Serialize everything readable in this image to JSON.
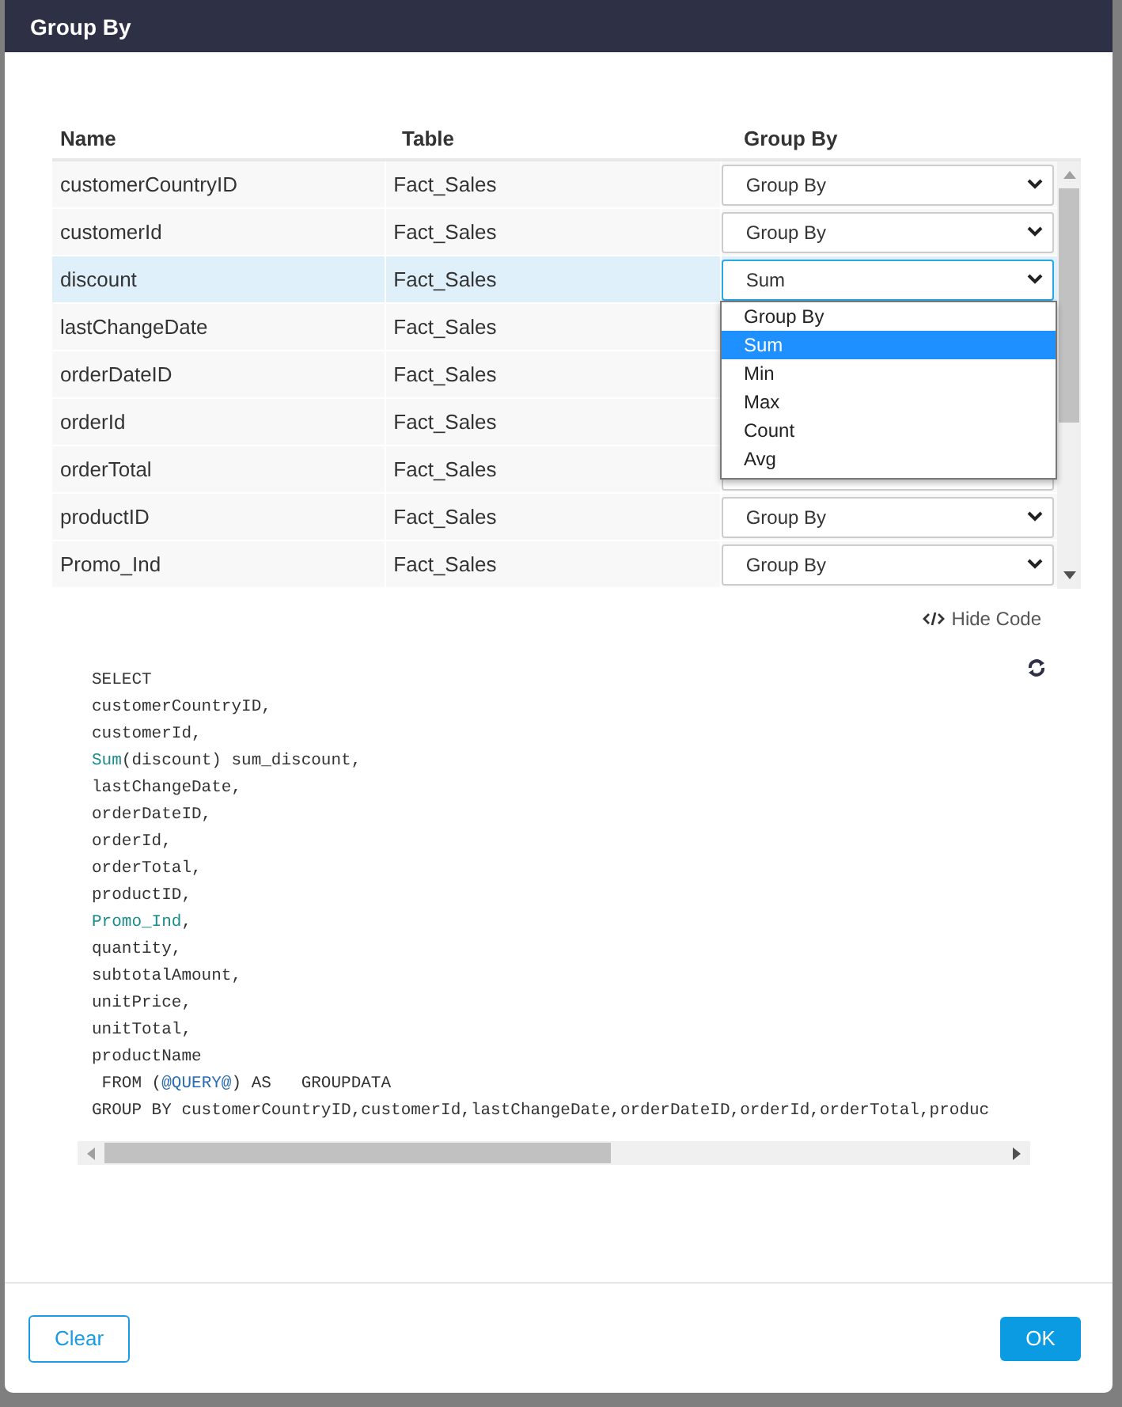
{
  "dialog": {
    "title": "Group By"
  },
  "table": {
    "columns": [
      "Name",
      "Table",
      "Group By"
    ],
    "rows": [
      {
        "name": "customerCountryID",
        "table": "Fact_Sales",
        "group_by": "Group By",
        "selected": false
      },
      {
        "name": "customerId",
        "table": "Fact_Sales",
        "group_by": "Group By",
        "selected": false
      },
      {
        "name": "discount",
        "table": "Fact_Sales",
        "group_by": "Sum",
        "selected": true,
        "menu": [
          {
            "label": "Group By",
            "selected": false
          },
          {
            "label": "Sum",
            "selected": true
          },
          {
            "label": "Min",
            "selected": false
          },
          {
            "label": "Max",
            "selected": false
          },
          {
            "label": "Count",
            "selected": false
          },
          {
            "label": "Avg",
            "selected": false
          }
        ]
      },
      {
        "name": "lastChangeDate",
        "table": "Fact_Sales",
        "selected": false
      },
      {
        "name": "orderDateID",
        "table": "Fact_Sales",
        "selected": false
      },
      {
        "name": "orderId",
        "table": "Fact_Sales",
        "selected": false
      },
      {
        "name": "orderTotal",
        "table": "Fact_Sales",
        "selected": false
      },
      {
        "name": "productID",
        "table": "Fact_Sales",
        "group_by": "Group By",
        "selected": false
      },
      {
        "name": "Promo_Ind",
        "table": "Fact_Sales",
        "group_by": "Group By",
        "selected": false
      }
    ]
  },
  "hide_code_link": "Hide Code",
  "code_lines": [
    [
      {
        "text": "SELECT",
        "kind": "plain"
      }
    ],
    [
      {
        "text": "customerCountryID,",
        "kind": "plain"
      }
    ],
    [
      {
        "text": "customerId,",
        "kind": "plain"
      }
    ],
    [
      {
        "text": "Sum",
        "kind": "function"
      },
      {
        "text": "(discount) sum_discount,",
        "kind": "plain"
      }
    ],
    [
      {
        "text": "lastChangeDate,",
        "kind": "plain"
      }
    ],
    [
      {
        "text": "orderDateID,",
        "kind": "plain"
      }
    ],
    [
      {
        "text": "orderId,",
        "kind": "plain"
      }
    ],
    [
      {
        "text": "orderTotal,",
        "kind": "plain"
      }
    ],
    [
      {
        "text": "productID,",
        "kind": "plain"
      }
    ],
    [
      {
        "text": "Promo_Ind",
        "kind": "function"
      },
      {
        "text": ",",
        "kind": "plain"
      }
    ],
    [
      {
        "text": "quantity,",
        "kind": "plain"
      }
    ],
    [
      {
        "text": "subtotalAmount,",
        "kind": "plain"
      }
    ],
    [
      {
        "text": "unitPrice,",
        "kind": "plain"
      }
    ],
    [
      {
        "text": "unitTotal,",
        "kind": "plain"
      }
    ],
    [
      {
        "text": "productName",
        "kind": "plain"
      }
    ],
    [
      {
        "text": " FROM (",
        "kind": "plain"
      },
      {
        "text": "@QUERY@",
        "kind": "parameter"
      },
      {
        "text": ") AS   GROUPDATA",
        "kind": "plain"
      }
    ],
    [
      {
        "text": "GROUP BY customerCountryID,customerId,lastChangeDate,orderDateID,orderId,orderTotal,produc",
        "kind": "plain"
      }
    ]
  ],
  "buttons": {
    "clear": "Clear",
    "ok": "OK"
  }
}
